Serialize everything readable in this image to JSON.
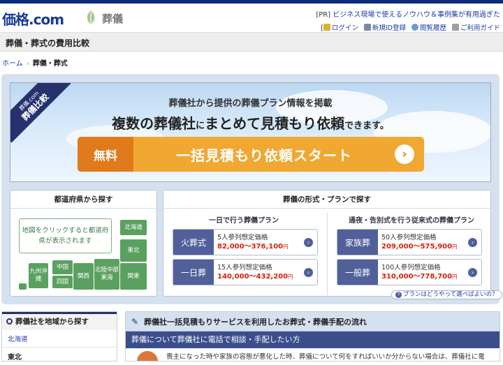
{
  "header": {
    "logo_main": "価格",
    "logo_dot": ".com",
    "section_name": "葬儀",
    "pr_tag": "[PR]",
    "pr_text": "ビジネス現場で使えるノウハウ＆事例集が有用過ぎた",
    "toolbar": {
      "login": "ログイン",
      "register": "新規ID登録",
      "history": "閲覧履歴",
      "guide": "ご利用ガイド"
    }
  },
  "page": {
    "title": "葬儀・葬式の費用比較",
    "breadcrumb": {
      "home": "ホーム",
      "current": "葬儀・葬式"
    }
  },
  "hero": {
    "ribbon_small": "葬儀.com",
    "ribbon_big": "葬儀比較",
    "line1": "葬儀社から提供の葬儀プラン情報を掲載",
    "line2_part1": "複数の葬儀社",
    "line2_part2": "に",
    "line2_part3": "まとめて見積もり依頼",
    "line2_part4": "できます。",
    "cta_free": "無料",
    "cta_text": "一括見積もり依頼スタート",
    "cta_arrow": "›"
  },
  "prefecture_box": {
    "title": "都道府県から探す",
    "map_note": "地図をクリックすると都道府県が表示されます",
    "regions": {
      "hokkaido": "北海道",
      "tohoku": "東北",
      "kanto": "関東",
      "hokuriku": "北陸中部東海",
      "kansai": "関西",
      "chugoku": "中国",
      "shikoku": "四国",
      "kyushu": "九州沖縄"
    }
  },
  "plan_box": {
    "title": "葬儀の形式・プランで探す",
    "col1_title": "一日で行う葬儀プラン",
    "col2_title": "通夜・告別式を行う従来式の葬儀プラン",
    "plans": [
      {
        "name": "火葬式",
        "people": "5人参列想定価格",
        "price": "82,000〜376,100",
        "unit": "円"
      },
      {
        "name": "一日葬",
        "people": "15人参列想定価格",
        "price": "140,000〜432,200",
        "unit": "円"
      },
      {
        "name": "家族葬",
        "people": "50人参列想定価格",
        "price": "209,000〜575,900",
        "unit": "円"
      },
      {
        "name": "一般葬",
        "people": "100人参列想定価格",
        "price": "310,000〜778,700",
        "unit": "円"
      }
    ],
    "help_text": "プランはどうやって選べばよいの？"
  },
  "sidebar": {
    "title": "葬儀社を地域から探す",
    "items": [
      "北海道",
      "東北"
    ]
  },
  "flow": {
    "title": "葬儀社一括見積もりサービスを利用したお葬式・葬儀手配の流れ",
    "band": "葬儀について葬儀社に電話で相談・手配したい方",
    "body": "喪主になった時や家族の容態が悪化した時、葬儀について何をすればいいか分からない場合は、葬儀社に電"
  }
}
